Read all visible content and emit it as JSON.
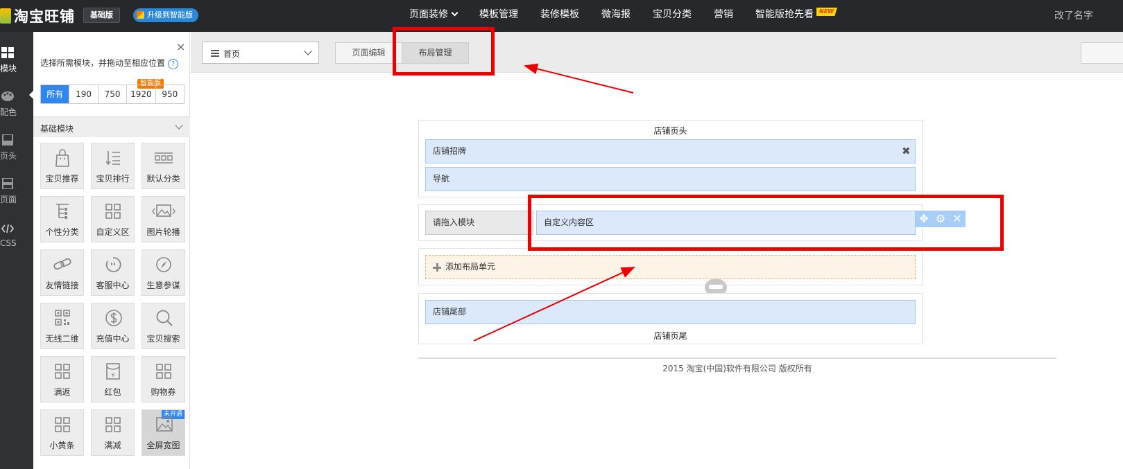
{
  "topbar": {
    "logo_text": "淘宝旺铺",
    "edition_badge": "基础版",
    "upgrade_label": "升级到智能版",
    "nav": [
      {
        "label": "页面装修"
      },
      {
        "label": "模板管理"
      },
      {
        "label": "装修模板"
      },
      {
        "label": "微海报"
      },
      {
        "label": "宝贝分类"
      },
      {
        "label": "营销"
      },
      {
        "label": "智能版抢先看"
      }
    ],
    "new_badge": "NEW",
    "user_name": "改了名字"
  },
  "rail": {
    "items": [
      {
        "label": "模块",
        "icon": "grid-icon"
      },
      {
        "label": "配色",
        "icon": "palette-icon"
      },
      {
        "label": "页头",
        "icon": "header-icon"
      },
      {
        "label": "页面",
        "icon": "page-icon"
      },
      {
        "label": "CSS",
        "icon": "code-icon"
      }
    ]
  },
  "panel": {
    "close": "×",
    "hint": "选择所需模块，并拖动至相应位置",
    "help": "?",
    "filters": [
      "所有",
      "190",
      "750",
      "1920",
      "950"
    ],
    "smart_tag": "智能版",
    "section_title": "基础模块",
    "tiles": [
      {
        "label": "宝贝推荐",
        "icon": "bag-icon"
      },
      {
        "label": "宝贝排行",
        "icon": "sort-list-icon"
      },
      {
        "label": "默认分类",
        "icon": "category-icon"
      },
      {
        "label": "个性分类",
        "icon": "tree-icon"
      },
      {
        "label": "自定义区",
        "icon": "custom-grid-icon"
      },
      {
        "label": "图片轮播",
        "icon": "image-carousel-icon"
      },
      {
        "label": "友情链接",
        "icon": "link-icon"
      },
      {
        "label": "客服中心",
        "icon": "service-icon"
      },
      {
        "label": "生意参谋",
        "icon": "compass-icon"
      },
      {
        "label": "无线二维",
        "icon": "qrcode-icon"
      },
      {
        "label": "充值中心",
        "icon": "dollar-icon"
      },
      {
        "label": "宝贝搜索",
        "icon": "search-icon"
      },
      {
        "label": "满返",
        "icon": "grid-icon"
      },
      {
        "label": "红包",
        "icon": "red-packet-icon"
      },
      {
        "label": "购物券",
        "icon": "grid-icon"
      },
      {
        "label": "小黄条",
        "icon": "grid-icon"
      },
      {
        "label": "满减",
        "icon": "grid-icon"
      },
      {
        "label": "全屏宽图",
        "icon": "image-icon",
        "badge": "未开通"
      }
    ]
  },
  "toolbar": {
    "page_select": "首页",
    "tabs": [
      "页面编辑",
      "布局管理"
    ]
  },
  "layout": {
    "header_title": "店铺页头",
    "header_modules": [
      "店铺招牌",
      "导航"
    ],
    "drop_slot": "请拖入模块",
    "custom_module": "自定义内容区",
    "add_unit": "添加布局单元",
    "footer_module": "店铺尾部",
    "footer_title": "店铺页尾",
    "copyright": "2015 淘宝(中国)软件有限公司 版权所有"
  },
  "colors": {
    "annotation_red": "#ee0000",
    "accent_blue": "#2f86f0",
    "module_blue": "#dbe9fb"
  }
}
